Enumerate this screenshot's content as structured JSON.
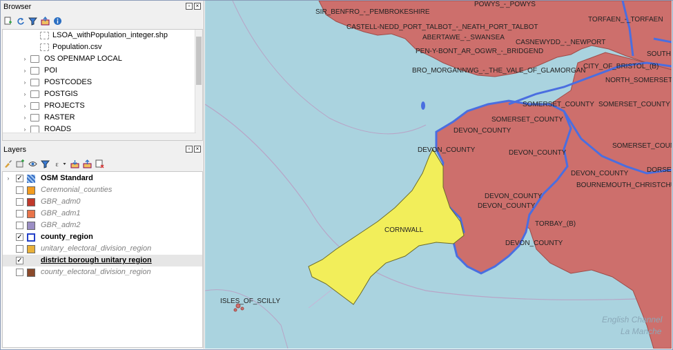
{
  "browser": {
    "title": "Browser",
    "items": [
      {
        "label": "LSOA_withPopulation_integer.shp",
        "kind": "file"
      },
      {
        "label": "Population.csv",
        "kind": "file"
      },
      {
        "label": "OS OPENMAP LOCAL",
        "kind": "folder"
      },
      {
        "label": "POI",
        "kind": "folder"
      },
      {
        "label": "POSTCODES",
        "kind": "folder"
      },
      {
        "label": "POSTGIS",
        "kind": "folder"
      },
      {
        "label": "PROJECTS",
        "kind": "folder"
      },
      {
        "label": "RASTER",
        "kind": "folder"
      },
      {
        "label": "ROADS",
        "kind": "folder"
      }
    ]
  },
  "layers": {
    "title": "Layers",
    "items": [
      {
        "label": "OSM Standard",
        "checked": true,
        "enabled": true,
        "swatch": "osm"
      },
      {
        "label": "Ceremonial_counties",
        "checked": false,
        "enabled": false,
        "swatch": "#f39c1f"
      },
      {
        "label": "GBR_adm0",
        "checked": false,
        "enabled": false,
        "swatch": "#c0392b"
      },
      {
        "label": "GBR_adm1",
        "checked": false,
        "enabled": false,
        "swatch": "#e8744a"
      },
      {
        "label": "GBR_adm2",
        "checked": false,
        "enabled": false,
        "swatch": "#9b8ec4"
      },
      {
        "label": "county_region",
        "checked": true,
        "enabled": true,
        "swatch": "outline"
      },
      {
        "label": "unitary_electoral_division_region",
        "checked": false,
        "enabled": false,
        "swatch": "#e9b13a"
      },
      {
        "label": "district borough unitary region",
        "checked": true,
        "enabled": true,
        "swatch": "none"
      },
      {
        "label": "county_electoral_division_region",
        "checked": false,
        "enabled": false,
        "swatch": "#8b4a2b"
      }
    ]
  },
  "map_labels": [
    "SIR_BENFRO_-_PEMBROKESHIRE",
    "CASTELL-NEDD_PORT_TALBOT_-_NEATH_PORT_TALBOT",
    "ABERTAWE_-_SWANSEA",
    "CASNEWYDD_-_NEWPORT",
    "PEN-Y-BONT_AR_OGWR_-_BRIDGEND",
    "BRO_MORGANNWG_-_THE_VALE_OF_GLAMORGAN",
    "CITY_OF_BRISTOL_(B)",
    "NORTH_SOMERSET",
    "SOMERSET_COUNTY",
    "SOMERSET_COUNTY",
    "SOMERSET_COUNTY",
    "SOMERSET_COUNTY",
    "DEVON_COUNTY",
    "DEVON_COUNTY",
    "DEVON_COUNTY",
    "DEVON_COUNTY",
    "DEVON_COUNTY",
    "DEVON_COUNTY",
    "DEVON_COUNTY",
    "CORNWALL",
    "TORBAY_(B)",
    "BOURNEMOUTH_CHRISTCHUR",
    "DORSET",
    "ISLES_OF_SCILLY",
    "TORFAEN_-_TORFAEN",
    "SOUTH",
    "POWYS_-_POWYS"
  ],
  "map_sea": [
    "English Channel",
    "La Manche"
  ],
  "colors": {
    "sea": "#aad3df",
    "land_fill": "#cd6f6c",
    "cornwall_fill": "#f2ee5a",
    "county_outline": "#4a6ee0"
  }
}
